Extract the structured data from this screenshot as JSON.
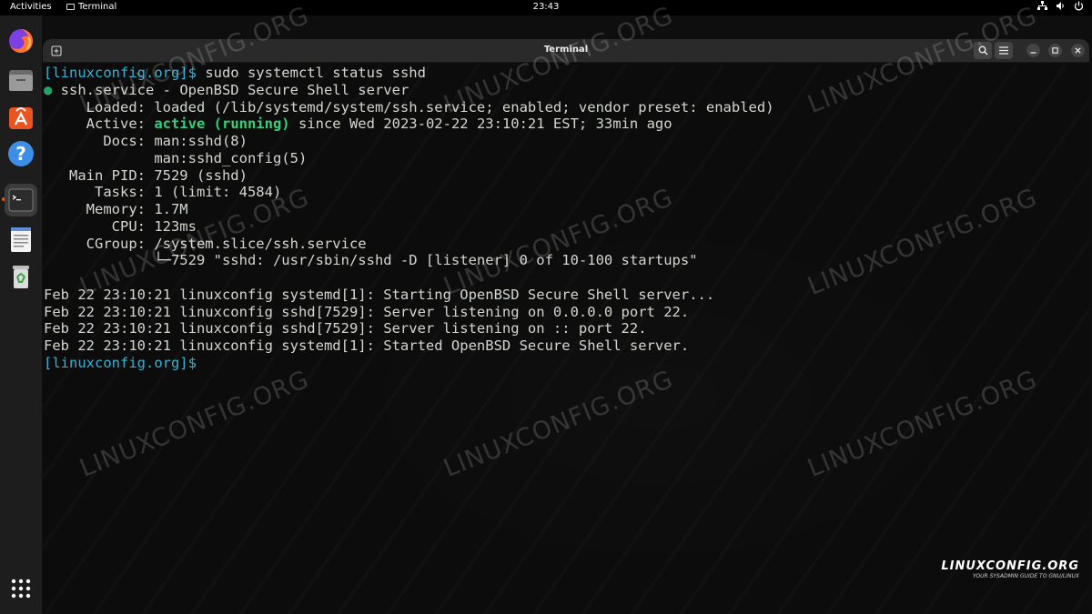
{
  "topbar": {
    "activities": "Activities",
    "app_name": "Terminal",
    "clock": "23:43",
    "tray_icons": [
      "network-icon",
      "volume-icon",
      "power-icon"
    ]
  },
  "dock": {
    "items": [
      "firefox-icon",
      "files-icon",
      "app-center-icon",
      "help-icon",
      "terminal-icon",
      "text-editor-icon",
      "trash-icon"
    ],
    "show_apps_icon": "app-grid-icon"
  },
  "window": {
    "title": "Terminal",
    "buttons": [
      "new-tab-icon",
      "search-icon",
      "menu-icon",
      "minimize-icon",
      "maximize-icon",
      "close-icon"
    ]
  },
  "terminal": {
    "prompt": "[linuxconfig.org]$",
    "command": " sudo systemctl status sshd",
    "bullet": "●",
    "lines": {
      "unit": " ssh.service - OpenBSD Secure Shell server",
      "loaded": "     Loaded: loaded (/lib/systemd/system/ssh.service; enabled; vendor preset: enabled)",
      "active_label": "     Active: ",
      "active_state": "active (running)",
      "active_rest": " since Wed 2023-02-22 23:10:21 EST; 33min ago",
      "docs1": "       Docs: man:sshd(8)",
      "docs2": "             man:sshd_config(5)",
      "mainpid": "   Main PID: 7529 (sshd)",
      "tasks": "      Tasks: 1 (limit: 4584)",
      "memory": "     Memory: 1.7M",
      "cpu": "        CPU: 123ms",
      "cgroup": "     CGroup: /system.slice/ssh.service",
      "cgroup_child": "             └─7529 \"sshd: /usr/sbin/sshd -D [listener] 0 of 10-100 startups\"",
      "log1": "Feb 22 23:10:21 linuxconfig systemd[1]: Starting OpenBSD Secure Shell server...",
      "log2": "Feb 22 23:10:21 linuxconfig sshd[7529]: Server listening on 0.0.0.0 port 22.",
      "log3": "Feb 22 23:10:21 linuxconfig sshd[7529]: Server listening on :: port 22.",
      "log4": "Feb 22 23:10:21 linuxconfig systemd[1]: Started OpenBSD Secure Shell server."
    }
  },
  "watermark": {
    "text": "LINUXCONFIG.ORG",
    "logo_main": "LINUXCONFIG.ORG",
    "logo_tagline": "YOUR SYSADMIN GUIDE TO GNU/LINUX"
  },
  "colors": {
    "prompt": "#34b3d8",
    "active_green": "#33d17a",
    "bullet_green": "#26a269",
    "text": "#d3d7cf",
    "accent": "#e95420"
  }
}
